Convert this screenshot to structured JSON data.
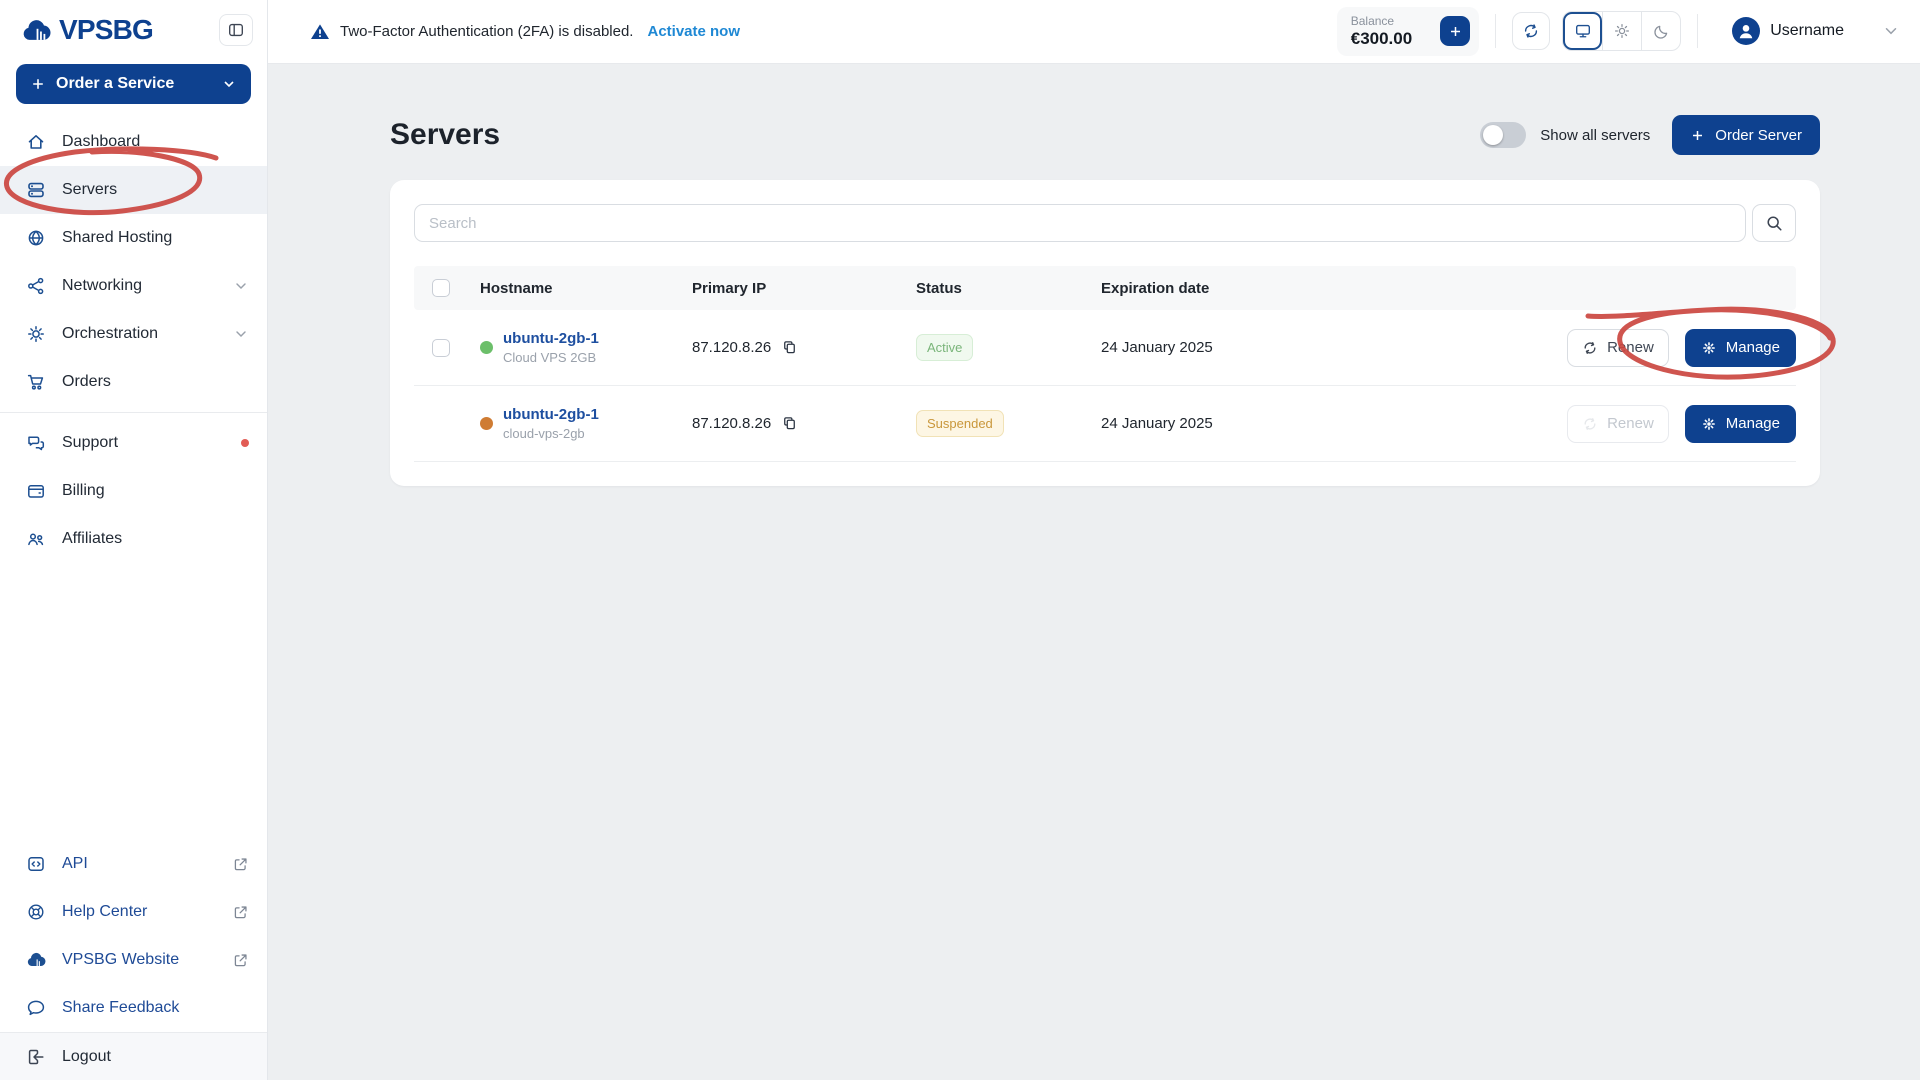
{
  "colors": {
    "accent": "#0e418f",
    "annotation": "#cb4740",
    "link": "#1e88d4",
    "active_status": "#7ab57a",
    "suspended_status": "#c9973b"
  },
  "brand": {
    "name": "VPSBG"
  },
  "topbar": {
    "warning_text": "Two-Factor Authentication (2FA) is disabled.",
    "warning_link": "Activate now",
    "balance_label": "Balance",
    "balance_value": "€300.00",
    "username": "Username"
  },
  "sidebar": {
    "order_button": "Order a Service",
    "items": [
      {
        "label": "Dashboard"
      },
      {
        "label": "Servers"
      },
      {
        "label": "Shared Hosting"
      },
      {
        "label": "Networking"
      },
      {
        "label": "Orchestration"
      },
      {
        "label": "Orders"
      },
      {
        "label": "Support"
      },
      {
        "label": "Billing"
      },
      {
        "label": "Affiliates"
      }
    ],
    "footer_items": [
      {
        "label": "API"
      },
      {
        "label": "Help Center"
      },
      {
        "label": "VPSBG Website"
      },
      {
        "label": "Share Feedback"
      }
    ],
    "logout_label": "Logout"
  },
  "main": {
    "title": "Servers",
    "show_all_label": "Show all servers",
    "order_server_label": "Order Server",
    "search_placeholder": "Search",
    "table": {
      "columns": [
        "Hostname",
        "Primary IP",
        "Status",
        "Expiration date"
      ],
      "renew_label": "Renew",
      "manage_label": "Manage",
      "rows": [
        {
          "hostname": "ubuntu-2gb-1",
          "plan": "Cloud VPS 2GB",
          "ip": "87.120.8.26",
          "status": "Active",
          "expiration": "24 January 2025",
          "dot_color": "#6cbf6a"
        },
        {
          "hostname": "ubuntu-2gb-1",
          "plan": "cloud-vps-2gb",
          "ip": "87.120.8.26",
          "status": "Suspended",
          "expiration": "24 January 2025",
          "dot_color": "#cf7c33"
        }
      ]
    }
  }
}
